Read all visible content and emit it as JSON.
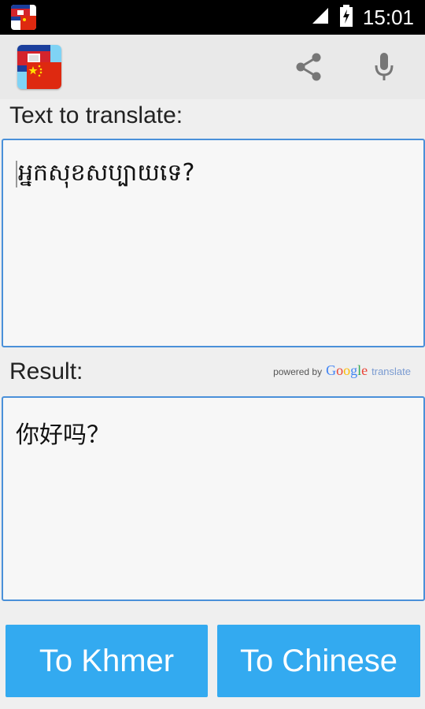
{
  "status_bar": {
    "time": "15:01",
    "icons": [
      "app-notification-icon",
      "signal-icon",
      "battery-charging-icon"
    ]
  },
  "action_bar": {
    "icons": [
      "app-logo-icon",
      "share-icon",
      "microphone-icon"
    ]
  },
  "input_section": {
    "label": "Text to translate:",
    "value": "អ្នកសុខសប្បាយទេ?"
  },
  "result_section": {
    "label": "Result:",
    "value": "你好吗？",
    "attribution": {
      "powered_by": "powered by",
      "google": [
        "G",
        "o",
        "o",
        "g",
        "l",
        "e"
      ],
      "translate": "translate"
    }
  },
  "buttons": {
    "to_khmer": "To Khmer",
    "to_chinese": "To Chinese"
  },
  "colors": {
    "accent": "#33aaf0",
    "border": "#4a90d9",
    "google": [
      "#4285f4",
      "#ea4335",
      "#fbbc05",
      "#4285f4",
      "#34a853",
      "#ea4335"
    ]
  }
}
